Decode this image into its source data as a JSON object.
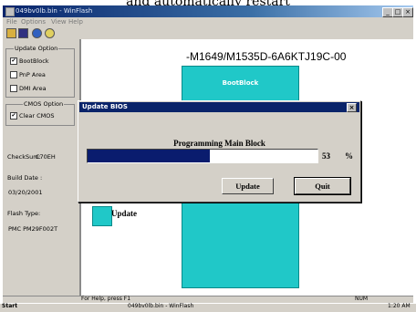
{
  "caption": "and automatically restart",
  "window": {
    "title": "049bv0lb.bin - WinFlash",
    "buttons": [
      "_",
      "□",
      "×"
    ]
  },
  "menu": [
    "File",
    "Options",
    "View",
    "Help"
  ],
  "toolbar": {
    "icons": [
      "open-icon",
      "save-icon",
      "flash-icon",
      "help-icon"
    ]
  },
  "left_panel": {
    "update_option_title": "Update Option",
    "options": [
      {
        "label": "BootBlock",
        "checked": true
      },
      {
        "label": "PnP Area",
        "checked": false
      },
      {
        "label": "DMI Area",
        "checked": false
      }
    ],
    "cmos_option_title": "CMOS Option",
    "clear_cmos": {
      "label": "Clear CMOS",
      "checked": true
    },
    "checksum_label": "CheckSum:",
    "checksum_value": "C70EH",
    "build_date_label": "Build Date :",
    "build_date_value": "03/20/2001",
    "flash_type_label": "Flash Type:",
    "flash_type_value": "PMC PM29F002T"
  },
  "main": {
    "model": "-M1649/M1535D-6A6KTJ19C-00",
    "bootblock_label": "BootBlock",
    "legend_label": "Update"
  },
  "dialog": {
    "title": "Update BIOS",
    "close": "×",
    "status": "Programming Main Block",
    "progress_percent": 53,
    "progress_value": "53",
    "percent_sign": "%",
    "update_button": "Update",
    "quit_button": "Quit"
  },
  "status_bar": {
    "help": "For Help, press F1",
    "num": "NUM"
  },
  "taskbar": {
    "start": "Start",
    "task": "049bv0lb.bin - WinFlash",
    "time": "1:20 AM"
  },
  "colors": {
    "title_blue": "#0a246a",
    "cyan": "#20c8c8",
    "progress": "#0a1c6e"
  }
}
